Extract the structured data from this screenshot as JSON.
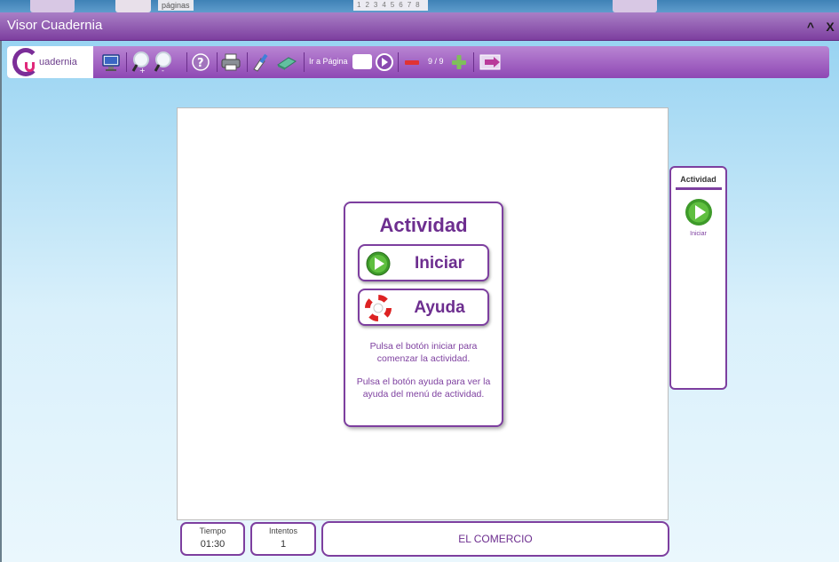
{
  "window": {
    "title": "Visor Cuadernia",
    "minimize_symbol": "^",
    "close_symbol": "X"
  },
  "background_bleed": {
    "tab_text": "páginas"
  },
  "toolbar": {
    "logo_text": "uadernia",
    "icons": [
      "monitor-icon",
      "zoom-in-icon",
      "zoom-out-icon",
      "help-icon",
      "print-icon",
      "clean-icon",
      "eraser-icon",
      "go-icon",
      "minus-icon",
      "plus-icon",
      "exit-icon"
    ],
    "goto_label": "Ir a Página",
    "goto_value": "",
    "page_count": "9 / 9"
  },
  "activity": {
    "title": "Actividad",
    "start_label": "Iniciar",
    "help_label": "Ayuda",
    "help_text_1": "Pulsa el botón iniciar para comenzar la actividad.",
    "help_text_2": "Pulsa el botón ayuda para ver la ayuda del menú de actividad."
  },
  "side_panel": {
    "title": "Actividad",
    "start_label": "Iniciar"
  },
  "status": {
    "time_label": "Tiempo",
    "time_value": "01:30",
    "attempts_label": "Intentos",
    "attempts_value": "1",
    "section_title": "EL COMERCIO"
  },
  "colors": {
    "accent": "#7d3f9f",
    "accent_light": "#b985d3",
    "text_purple": "#6d2e8f",
    "play_green": "#3e9a2a",
    "sky": "#8fcff0"
  }
}
